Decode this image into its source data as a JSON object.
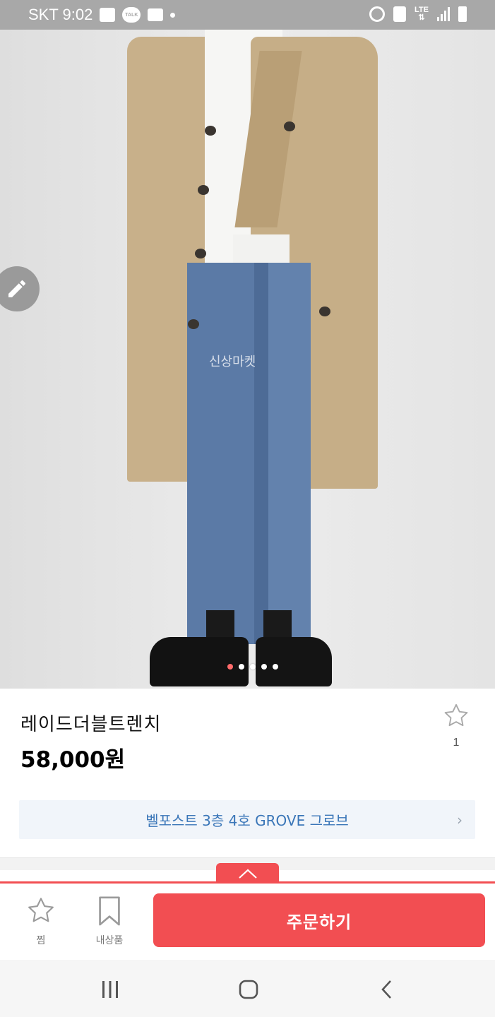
{
  "status_bar": {
    "carrier": "SKT",
    "time": "9:02",
    "talk_badge": "TALK",
    "network": "LTE",
    "icons": [
      "gallery-icon",
      "kakaotalk-icon",
      "message-icon",
      "dot-icon",
      "alarm-icon",
      "recycle-icon",
      "lte-icon",
      "signal-icon",
      "battery-icon"
    ]
  },
  "product": {
    "image_watermark": "신상마켓",
    "image_pages": 5,
    "image_active_page": 1,
    "name": "레이드더블트렌치",
    "price": "58,000원",
    "favorite_count": "1"
  },
  "shop": {
    "label": "벨포스트 3층 4호 GROVE 그로브",
    "chevron": "›"
  },
  "action_bar": {
    "wish_label": "찜",
    "my_items_label": "내상품",
    "order_label": "주문하기"
  },
  "colors": {
    "accent": "#f24e52",
    "shop_text": "#3a76b8",
    "shop_bg": "#f1f5fa"
  }
}
